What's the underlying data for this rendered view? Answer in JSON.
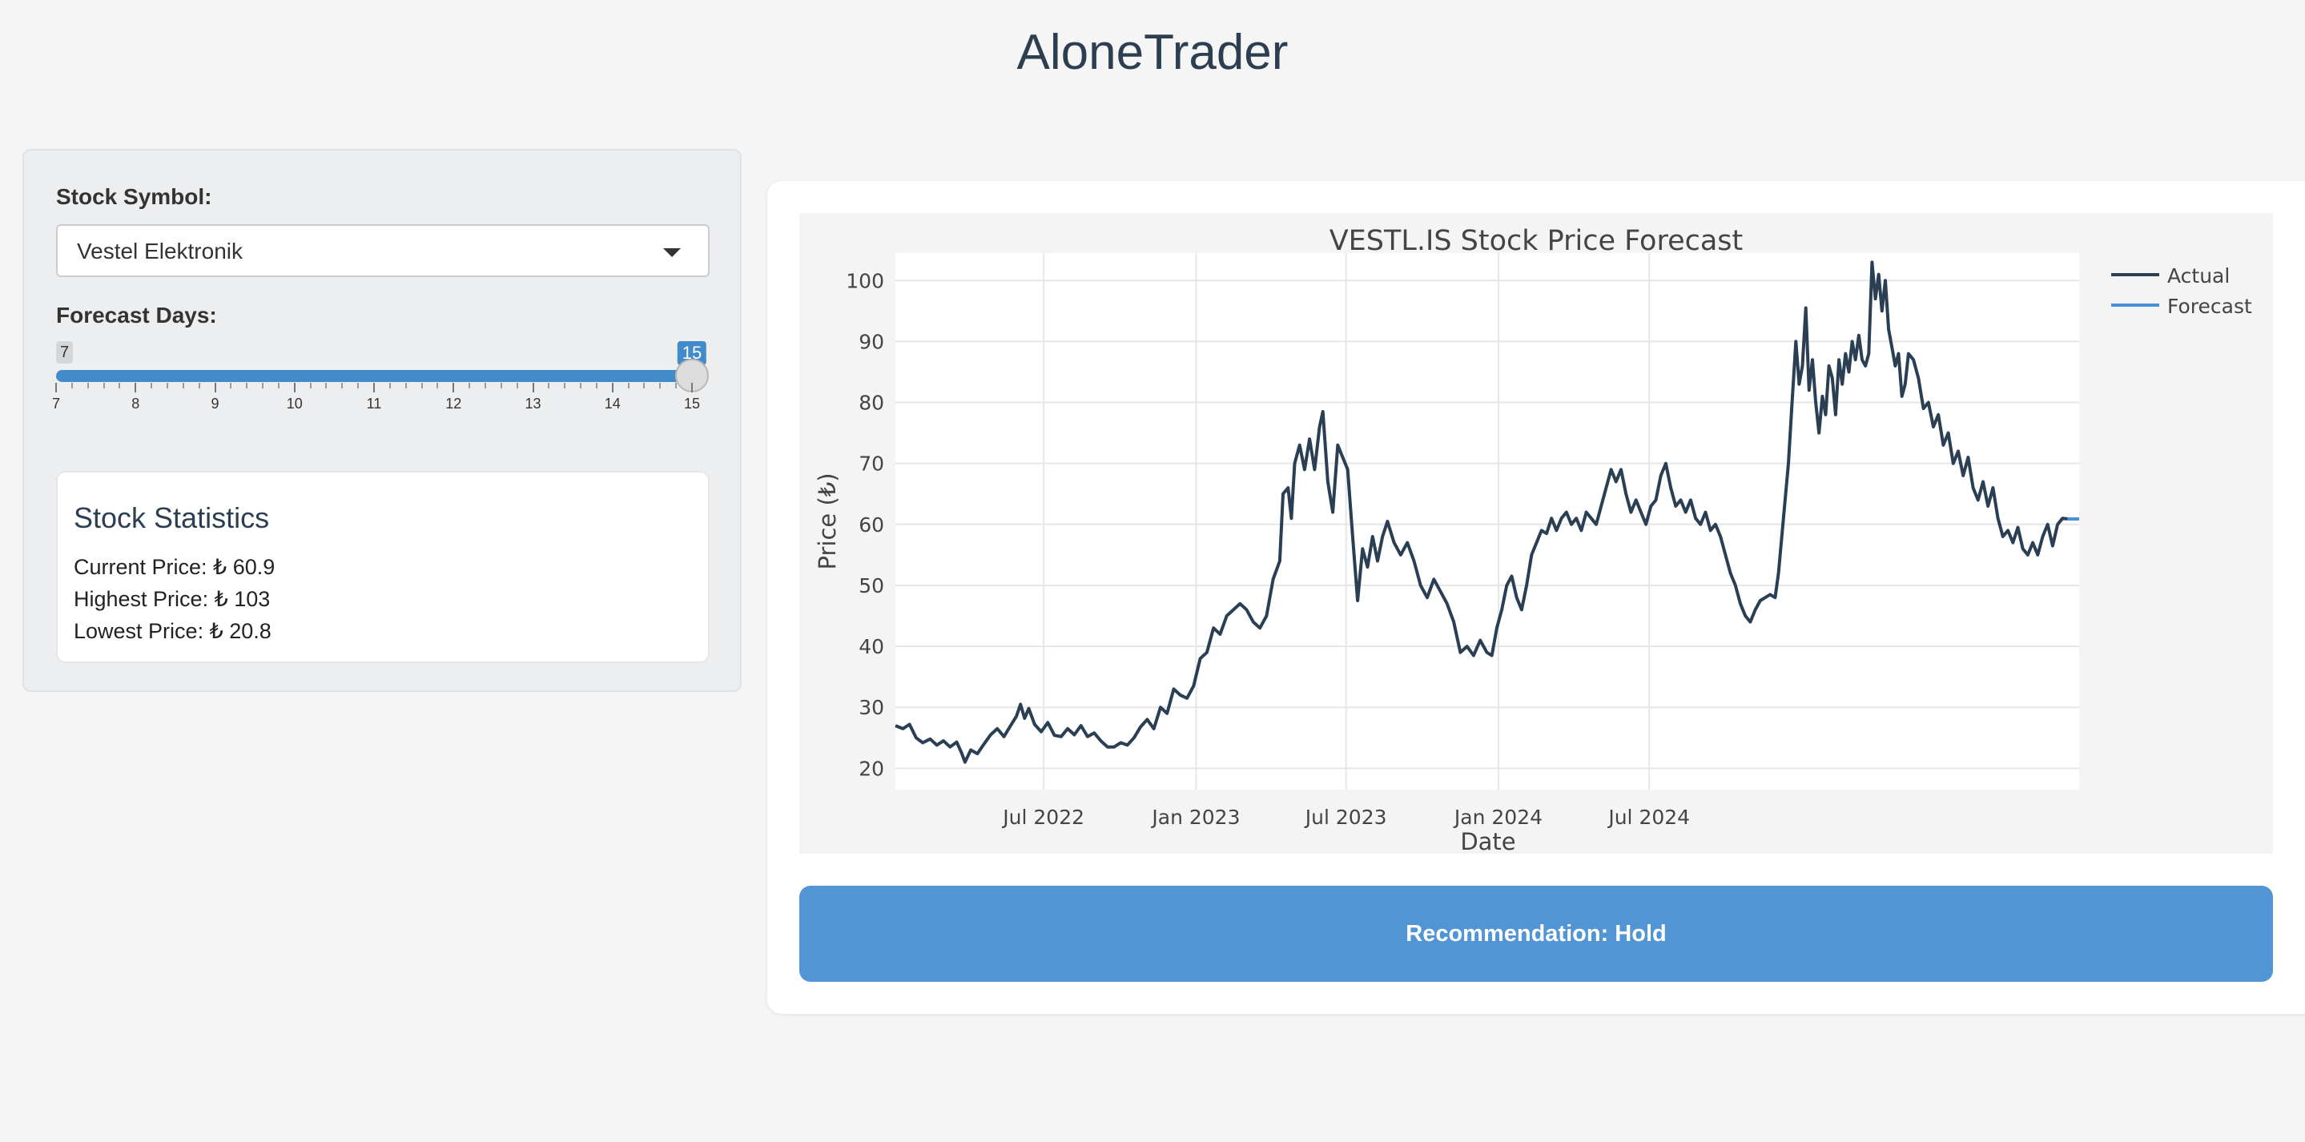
{
  "app": {
    "title": "AloneTrader"
  },
  "sidebar": {
    "symbol_label": "Stock Symbol:",
    "symbol_value": "Vestel Elektronik",
    "forecast_label": "Forecast Days:",
    "slider": {
      "min": 7,
      "max": 15,
      "value": 15,
      "ticks": [
        "7",
        "8",
        "9",
        "10",
        "11",
        "12",
        "13",
        "14",
        "15"
      ]
    },
    "stats": {
      "title": "Stock Statistics",
      "current": "Current Price: ₺ 60.9",
      "highest": "Highest Price: ₺ 103",
      "lowest": "Lowest Price: ₺ 20.8"
    }
  },
  "recommendation": "Recommendation: Hold",
  "colors": {
    "accent": "#428bca",
    "actual_line": "#2a3f54",
    "forecast_line": "#4a90d9",
    "button": "#5295d4"
  },
  "chart_data": {
    "type": "line",
    "title": "VESTL.IS Stock Price Forecast",
    "xlabel": "Date",
    "ylabel": "Price (₺)",
    "ylim": [
      16.5,
      104.5
    ],
    "yticks": [
      20,
      30,
      40,
      50,
      60,
      70,
      80,
      90,
      100
    ],
    "xlim": [
      "2022-01-03",
      "2024-11-28"
    ],
    "xticks": [
      {
        "date": "2022-07-01",
        "label": "Jul 2022"
      },
      {
        "date": "2023-01-01",
        "label": "Jan 2023"
      },
      {
        "date": "2023-07-01",
        "label": "Jul 2023"
      },
      {
        "date": "2024-01-01",
        "label": "Jan 2024"
      },
      {
        "date": "2024-07-01",
        "label": "Jul 2024"
      }
    ],
    "grid": true,
    "legend_position": "top-right",
    "series": [
      {
        "name": "Actual",
        "color": "#2a3f54",
        "points": [
          [
            "2022-01-03",
            27
          ],
          [
            "2022-01-12",
            26.5
          ],
          [
            "2022-01-20",
            27.2
          ],
          [
            "2022-01-28",
            25
          ],
          [
            "2022-02-05",
            24.2
          ],
          [
            "2022-02-14",
            24.8
          ],
          [
            "2022-02-22",
            23.8
          ],
          [
            "2022-03-02",
            24.5
          ],
          [
            "2022-03-10",
            23.5
          ],
          [
            "2022-03-18",
            24.3
          ],
          [
            "2022-03-24",
            22.5
          ],
          [
            "2022-03-28",
            21
          ],
          [
            "2022-04-04",
            23
          ],
          [
            "2022-04-12",
            22.4
          ],
          [
            "2022-04-20",
            24
          ],
          [
            "2022-04-28",
            25.5
          ],
          [
            "2022-05-06",
            26.5
          ],
          [
            "2022-05-14",
            25.2
          ],
          [
            "2022-05-22",
            27
          ],
          [
            "2022-05-29",
            28.5
          ],
          [
            "2022-06-03",
            30.5
          ],
          [
            "2022-06-08",
            28.2
          ],
          [
            "2022-06-13",
            29.8
          ],
          [
            "2022-06-20",
            27.2
          ],
          [
            "2022-06-28",
            26
          ],
          [
            "2022-07-06",
            27.5
          ],
          [
            "2022-07-14",
            25.4
          ],
          [
            "2022-07-22",
            25.2
          ],
          [
            "2022-07-30",
            26.5
          ],
          [
            "2022-08-07",
            25.5
          ],
          [
            "2022-08-15",
            27
          ],
          [
            "2022-08-23",
            25.2
          ],
          [
            "2022-08-31",
            25.8
          ],
          [
            "2022-09-08",
            24.5
          ],
          [
            "2022-09-16",
            23.5
          ],
          [
            "2022-09-24",
            23.5
          ],
          [
            "2022-10-02",
            24.2
          ],
          [
            "2022-10-10",
            23.8
          ],
          [
            "2022-10-18",
            25
          ],
          [
            "2022-10-26",
            26.8
          ],
          [
            "2022-11-03",
            28
          ],
          [
            "2022-11-11",
            26.5
          ],
          [
            "2022-11-19",
            30
          ],
          [
            "2022-11-27",
            29
          ],
          [
            "2022-12-05",
            33
          ],
          [
            "2022-12-13",
            32
          ],
          [
            "2022-12-21",
            31.5
          ],
          [
            "2022-12-29",
            33.5
          ],
          [
            "2023-01-06",
            38
          ],
          [
            "2023-01-14",
            39
          ],
          [
            "2023-01-22",
            43
          ],
          [
            "2023-01-30",
            42
          ],
          [
            "2023-02-07",
            45
          ],
          [
            "2023-02-15",
            46
          ],
          [
            "2023-02-23",
            47
          ],
          [
            "2023-03-03",
            46
          ],
          [
            "2023-03-11",
            44
          ],
          [
            "2023-03-19",
            43
          ],
          [
            "2023-03-27",
            45
          ],
          [
            "2023-04-04",
            51
          ],
          [
            "2023-04-12",
            54
          ],
          [
            "2023-04-16",
            65
          ],
          [
            "2023-04-22",
            66
          ],
          [
            "2023-04-26",
            61
          ],
          [
            "2023-04-30",
            70
          ],
          [
            "2023-05-06",
            73
          ],
          [
            "2023-05-12",
            69
          ],
          [
            "2023-05-18",
            74
          ],
          [
            "2023-05-24",
            69
          ],
          [
            "2023-05-30",
            76
          ],
          [
            "2023-06-03",
            78.5
          ],
          [
            "2023-06-09",
            67
          ],
          [
            "2023-06-15",
            62
          ],
          [
            "2023-06-21",
            73
          ],
          [
            "2023-06-27",
            71
          ],
          [
            "2023-07-03",
            69
          ],
          [
            "2023-07-09",
            58
          ],
          [
            "2023-07-15",
            47.5
          ],
          [
            "2023-07-21",
            56
          ],
          [
            "2023-07-27",
            53
          ],
          [
            "2023-08-02",
            58
          ],
          [
            "2023-08-08",
            54
          ],
          [
            "2023-08-14",
            58
          ],
          [
            "2023-08-20",
            60.5
          ],
          [
            "2023-08-28",
            57
          ],
          [
            "2023-09-05",
            55
          ],
          [
            "2023-09-13",
            57
          ],
          [
            "2023-09-21",
            54
          ],
          [
            "2023-09-29",
            50
          ],
          [
            "2023-10-07",
            48
          ],
          [
            "2023-10-15",
            51
          ],
          [
            "2023-10-23",
            49
          ],
          [
            "2023-10-31",
            47
          ],
          [
            "2023-11-08",
            44
          ],
          [
            "2023-11-16",
            39
          ],
          [
            "2023-11-24",
            40
          ],
          [
            "2023-12-02",
            38.5
          ],
          [
            "2023-12-10",
            41
          ],
          [
            "2023-12-18",
            39
          ],
          [
            "2023-12-24",
            38.5
          ],
          [
            "2023-12-30",
            43
          ],
          [
            "2024-01-05",
            46
          ],
          [
            "2024-01-11",
            50
          ],
          [
            "2024-01-17",
            51.5
          ],
          [
            "2024-01-23",
            48
          ],
          [
            "2024-01-29",
            46
          ],
          [
            "2024-02-04",
            50
          ],
          [
            "2024-02-10",
            55
          ],
          [
            "2024-02-16",
            57
          ],
          [
            "2024-02-22",
            59
          ],
          [
            "2024-02-28",
            58.5
          ],
          [
            "2024-03-05",
            61
          ],
          [
            "2024-03-11",
            59
          ],
          [
            "2024-03-17",
            61
          ],
          [
            "2024-03-23",
            62
          ],
          [
            "2024-03-29",
            60
          ],
          [
            "2024-04-04",
            61
          ],
          [
            "2024-04-10",
            59
          ],
          [
            "2024-04-16",
            62
          ],
          [
            "2024-04-22",
            61
          ],
          [
            "2024-04-28",
            60
          ],
          [
            "2024-05-04",
            63
          ],
          [
            "2024-05-10",
            66
          ],
          [
            "2024-05-16",
            69
          ],
          [
            "2024-05-22",
            67
          ],
          [
            "2024-05-28",
            69
          ],
          [
            "2024-06-03",
            65
          ],
          [
            "2024-06-09",
            62
          ],
          [
            "2024-06-15",
            64
          ],
          [
            "2024-06-21",
            62
          ],
          [
            "2024-06-27",
            60
          ],
          [
            "2024-07-03",
            63
          ],
          [
            "2024-07-09",
            64
          ],
          [
            "2024-07-15",
            68
          ],
          [
            "2024-07-21",
            70
          ],
          [
            "2024-07-27",
            66
          ],
          [
            "2024-08-02",
            63
          ],
          [
            "2024-08-08",
            64
          ],
          [
            "2024-08-14",
            62
          ],
          [
            "2024-08-20",
            64
          ],
          [
            "2024-08-26",
            61
          ],
          [
            "2024-09-01",
            60
          ],
          [
            "2024-09-07",
            62
          ],
          [
            "2024-09-13",
            59
          ],
          [
            "2024-09-19",
            60
          ],
          [
            "2024-09-25",
            58
          ],
          [
            "2024-10-01",
            55
          ],
          [
            "2024-10-07",
            52
          ],
          [
            "2024-10-13",
            50
          ],
          [
            "2024-10-19",
            47
          ],
          [
            "2024-10-25",
            45
          ],
          [
            "2024-10-31",
            44
          ],
          [
            "2024-11-06",
            46
          ],
          [
            "2024-11-12",
            47.5
          ],
          [
            "2024-11-18",
            48
          ],
          [
            "2024-11-24",
            48.5
          ],
          [
            "2024-11-30",
            48
          ],
          [
            "2024-12-04",
            52
          ],
          [
            "2024-12-10",
            61
          ],
          [
            "2024-12-16",
            70
          ],
          [
            "2024-12-20",
            79
          ],
          [
            "2024-12-25",
            90
          ],
          [
            "2024-12-29",
            83
          ],
          [
            "2025-01-02",
            86
          ],
          [
            "2025-01-06",
            95.5
          ],
          [
            "2025-01-10",
            82
          ],
          [
            "2025-01-14",
            87
          ],
          [
            "2025-01-18",
            80
          ],
          [
            "2025-01-22",
            75
          ],
          [
            "2025-01-26",
            81
          ],
          [
            "2025-01-30",
            78
          ],
          [
            "2025-02-03",
            86
          ],
          [
            "2025-02-07",
            84
          ],
          [
            "2025-02-11",
            78
          ],
          [
            "2025-02-15",
            87
          ],
          [
            "2025-02-19",
            83
          ],
          [
            "2025-02-23",
            88
          ],
          [
            "2025-02-27",
            85
          ],
          [
            "2025-03-03",
            90
          ],
          [
            "2025-03-07",
            87
          ],
          [
            "2025-03-11",
            91
          ],
          [
            "2025-03-15",
            87
          ],
          [
            "2025-03-19",
            86
          ],
          [
            "2025-03-23",
            88
          ],
          [
            "2025-03-27",
            103
          ],
          [
            "2025-03-31",
            97
          ],
          [
            "2025-04-04",
            101
          ],
          [
            "2025-04-08",
            95
          ],
          [
            "2025-04-12",
            100
          ],
          [
            "2025-04-16",
            92
          ],
          [
            "2025-04-20",
            89
          ],
          [
            "2025-04-24",
            86
          ],
          [
            "2025-04-28",
            88
          ],
          [
            "2025-05-02",
            81
          ],
          [
            "2025-05-06",
            83
          ],
          [
            "2025-05-10",
            88
          ],
          [
            "2025-05-16",
            87
          ],
          [
            "2025-05-22",
            84
          ],
          [
            "2025-05-28",
            79
          ],
          [
            "2025-06-03",
            80
          ],
          [
            "2025-06-09",
            76
          ],
          [
            "2025-06-15",
            78
          ],
          [
            "2025-06-21",
            73
          ],
          [
            "2025-06-27",
            75
          ],
          [
            "2025-07-03",
            70
          ],
          [
            "2025-07-09",
            72
          ],
          [
            "2025-07-15",
            68
          ],
          [
            "2025-07-21",
            71
          ],
          [
            "2025-07-27",
            66
          ],
          [
            "2025-08-02",
            64
          ],
          [
            "2025-08-08",
            67
          ],
          [
            "2025-08-14",
            63
          ],
          [
            "2025-08-20",
            66
          ],
          [
            "2025-08-26",
            61
          ],
          [
            "2025-09-01",
            58
          ],
          [
            "2025-09-07",
            59
          ],
          [
            "2025-09-13",
            57
          ],
          [
            "2025-09-19",
            59.5
          ],
          [
            "2025-09-25",
            56
          ],
          [
            "2025-10-01",
            55
          ],
          [
            "2025-10-07",
            57
          ],
          [
            "2025-10-13",
            55
          ],
          [
            "2025-10-19",
            58
          ],
          [
            "2025-10-25",
            60
          ],
          [
            "2025-10-31",
            56.5
          ],
          [
            "2025-11-06",
            60
          ],
          [
            "2025-11-12",
            61
          ],
          [
            "2025-11-18",
            60.9
          ]
        ]
      },
      {
        "name": "Forecast",
        "color": "#4a90d9",
        "points": [
          [
            "2025-11-18",
            60.9
          ],
          [
            "2025-12-02",
            60.9
          ]
        ]
      }
    ]
  }
}
